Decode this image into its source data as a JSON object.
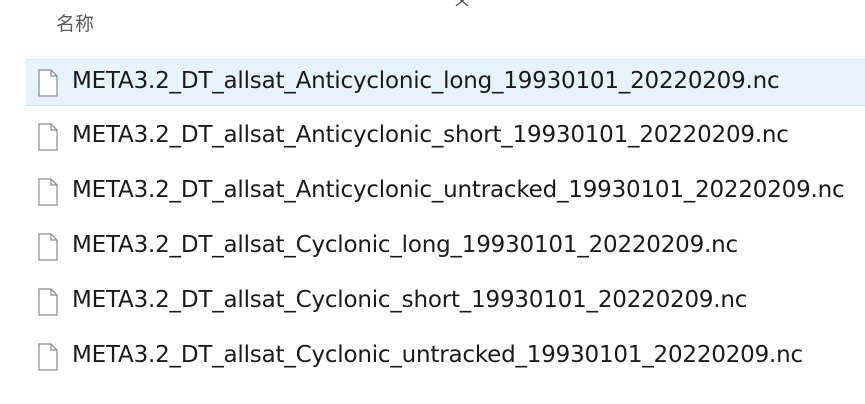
{
  "header": {
    "column_name": "名称"
  },
  "files": [
    {
      "name": "META3.2_DT_allsat_Anticyclonic_long_19930101_20220209.nc",
      "selected": true
    },
    {
      "name": "META3.2_DT_allsat_Anticyclonic_short_19930101_20220209.nc",
      "selected": false
    },
    {
      "name": "META3.2_DT_allsat_Anticyclonic_untracked_19930101_20220209.nc",
      "selected": false
    },
    {
      "name": "META3.2_DT_allsat_Cyclonic_long_19930101_20220209.nc",
      "selected": false
    },
    {
      "name": "META3.2_DT_allsat_Cyclonic_short_19930101_20220209.nc",
      "selected": false
    },
    {
      "name": "META3.2_DT_allsat_Cyclonic_untracked_19930101_20220209.nc",
      "selected": false
    }
  ],
  "icons": {
    "file": "document-icon",
    "close": "close-icon"
  },
  "colors": {
    "selection_background": "#e5f3fb",
    "selection_border": "#cce8f6",
    "header_text": "#5a5a5a",
    "file_text": "#1a1a1a"
  }
}
